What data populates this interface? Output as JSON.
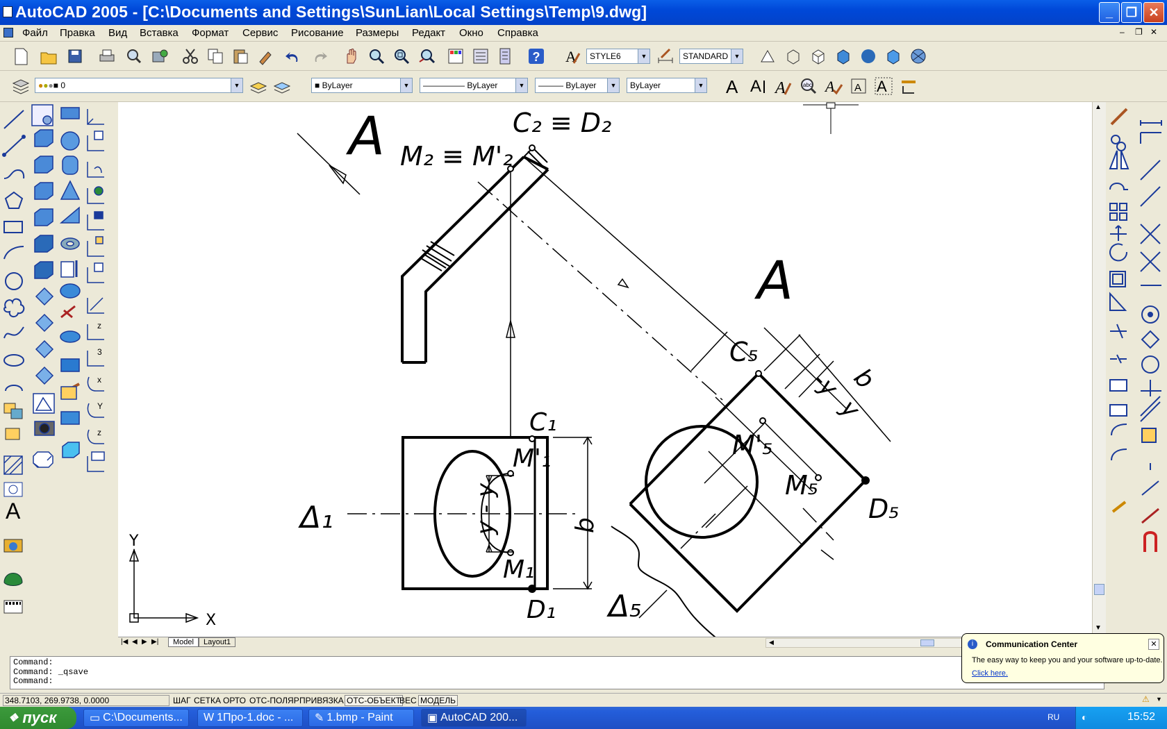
{
  "window": {
    "title": "AutoCAD 2005 - [C:\\Documents and Settings\\SunLian\\Local Settings\\Temp\\9.dwg]",
    "minimize": "_",
    "restore": "❐",
    "close": "✕"
  },
  "menu": {
    "items": [
      "Файл",
      "Правка",
      "Вид",
      "Вставка",
      "Формат",
      "Сервис",
      "Рисование",
      "Размеры",
      "Редакт",
      "Окно",
      "Справка"
    ]
  },
  "toolbar": {
    "text_style": "STYLE6",
    "dim_style": "STANDARD",
    "layer": "0",
    "color": "ByLayer",
    "linetype": "ByLayer",
    "lineweight": "ByLayer",
    "plotstyle": "ByLayer"
  },
  "drawing": {
    "view_label_top": "A",
    "view_label_right": "A",
    "c2_d2": "C₂ ≡ D₂",
    "m2": "M₂ ≡ M'₂",
    "c1": "C₁",
    "m1p": "M'₁",
    "m1": "M₁",
    "d1": "D₁",
    "delta1": "Δ₁",
    "b_dim": "b",
    "yy_dim": "y - y",
    "c5": "C₅",
    "m5p": "M'₅",
    "m5": "M₅",
    "d5": "D₅",
    "delta5": "Δ₅",
    "b5": "b",
    "y5a": "-y",
    "y5b": "y",
    "ucs_y": "Y",
    "ucs_x": "X"
  },
  "tabs": {
    "model": "Model",
    "layout1": "Layout1"
  },
  "command": {
    "lines": [
      "Command:",
      "Command: _qsave",
      "Command:"
    ]
  },
  "status": {
    "coords": "348.7103, 269.9738, 0.0000",
    "buttons": [
      "ШАГ",
      "СЕТКА",
      "ОРТО",
      "ОТС-ПОЛЯР",
      "ПРИВЯЗКА",
      "ОТС-ОБЪЕКТ",
      "ВЕС",
      "МОДЕЛЬ"
    ]
  },
  "comm_center": {
    "title": "Communication Center",
    "body": "The easy way to keep you and your software up-to-date.",
    "link": "Click here."
  },
  "taskbar": {
    "start": "пуск",
    "tasks": [
      "C:\\Documents...",
      "1Про-1.doc - ...",
      "1.bmp - Paint",
      "AutoCAD 200..."
    ],
    "lang": "RU",
    "clock": "15:52"
  }
}
